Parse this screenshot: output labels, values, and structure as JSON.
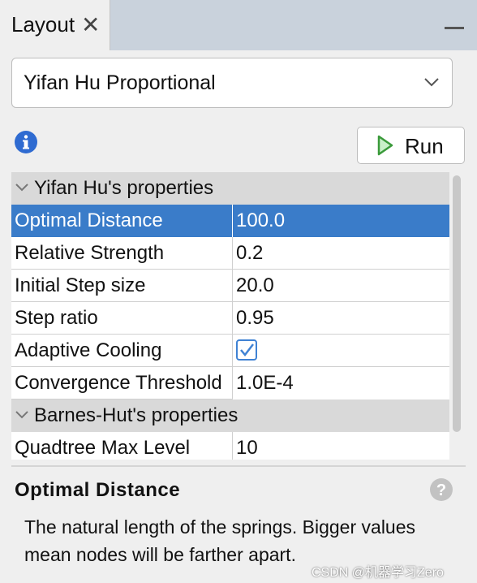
{
  "tab": {
    "title": "Layout",
    "close_icon": "close-icon"
  },
  "dropdown": {
    "selected": "Yifan Hu Proportional"
  },
  "toolbar": {
    "run_label": "Run"
  },
  "sections": [
    {
      "label": "Yifan Hu's properties"
    },
    {
      "label": "Barnes-Hut's properties"
    }
  ],
  "properties": [
    {
      "name": "Optimal Distance",
      "value": "100.0",
      "selected": true
    },
    {
      "name": "Relative Strength",
      "value": "0.2"
    },
    {
      "name": "Initial Step size",
      "value": "20.0"
    },
    {
      "name": "Step ratio",
      "value": "0.95"
    },
    {
      "name": "Adaptive Cooling",
      "value": "",
      "checked": true
    },
    {
      "name": "Convergence Threshold",
      "value": "1.0E-4"
    },
    {
      "name": "Quadtree Max Level",
      "value": "10"
    }
  ],
  "description": {
    "title": "Optimal Distance",
    "text": "The natural length of the springs. Bigger values mean nodes will be farther apart."
  },
  "watermark": "CSDN @机器学习Zero",
  "colors": {
    "selection": "#3a7cc9",
    "tabbar": "#c9d2dc",
    "checkbox": "#3f82d4",
    "run_arrow": "#3a9a3a"
  }
}
